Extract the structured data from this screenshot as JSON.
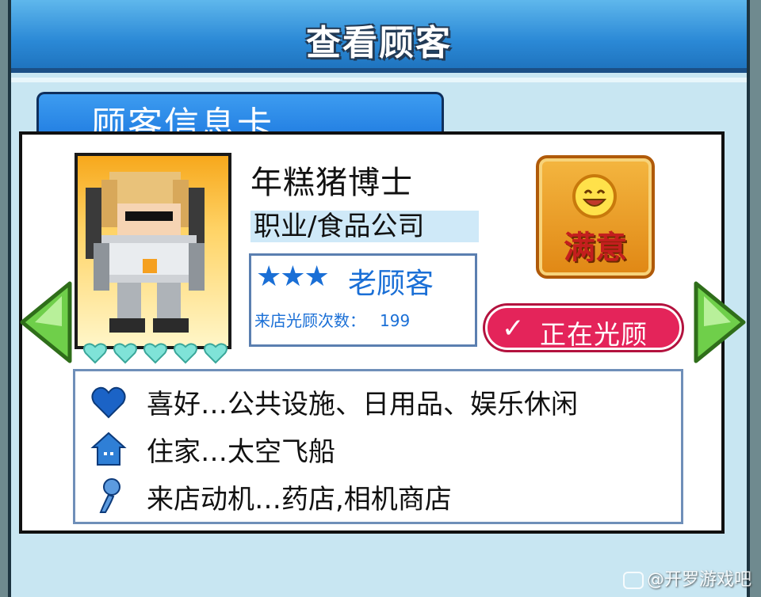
{
  "header": {
    "title": "查看顾客"
  },
  "tab": {
    "label": "顾客信息卡"
  },
  "customer": {
    "name": "年糕猪博士",
    "job": "职业/食品公司",
    "stars": "★★★",
    "rank": "老顾客",
    "visits_label": "来店光顾次数：",
    "visits_count": "199",
    "mood": "满意",
    "status": "正在光顾",
    "status_icon": "check-icon",
    "hearts": 5
  },
  "details": {
    "likes": "喜好…公共设施、日用品、娱乐休闲",
    "home": "住家…太空飞船",
    "motive": "来店动机…药店,相机商店"
  },
  "colors": {
    "title_blue": "#2b89d6",
    "status_red": "#e4245a",
    "rank_blue": "#1a6fd6",
    "heart_teal": "#7fe3d8",
    "mood_orange": "#f4b640"
  },
  "watermark": "@开罗游戏吧"
}
